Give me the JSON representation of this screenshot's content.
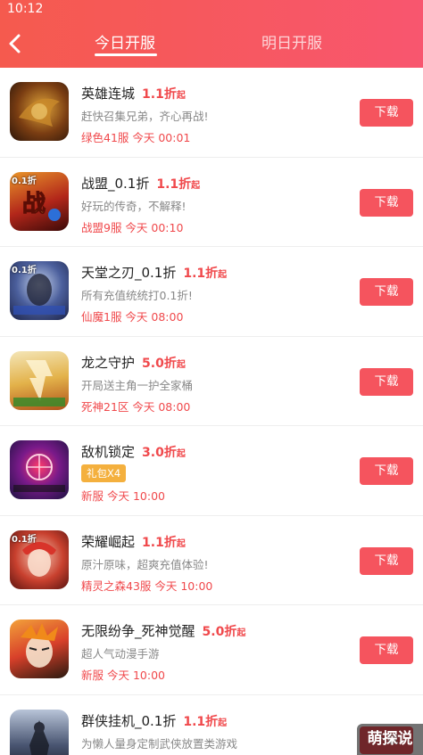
{
  "status": {
    "time": "10:12"
  },
  "header": {
    "tabs": [
      {
        "label": "今日开服",
        "active": true
      },
      {
        "label": "明日开服",
        "active": false
      }
    ]
  },
  "download_label": "下载",
  "games": [
    {
      "name": "英雄连城",
      "discount": "1.1折",
      "suffix": "起",
      "desc": "赶快召集兄弟，齐心再战!",
      "server": "绿色41服 今天 00:01",
      "icon": "hero-castle-icon"
    },
    {
      "name": "战盟_0.1折",
      "discount": "1.1折",
      "suffix": "起",
      "desc": "好玩的传奇，不解释!",
      "server": "战盟9服 今天 00:10",
      "icon": "war-alliance-icon",
      "badge": "0.1折"
    },
    {
      "name": "天堂之刃_0.1折",
      "discount": "1.1折",
      "suffix": "起",
      "desc": "所有充值统统打0.1折!",
      "server": "仙魔1服 今天 08:00",
      "icon": "heaven-blade-icon",
      "badge": "0.1折"
    },
    {
      "name": "龙之守护",
      "discount": "5.0折",
      "suffix": "起",
      "desc": "开局送主角一护全家桶",
      "server": "死神21区 今天 08:00",
      "icon": "dragon-guard-icon"
    },
    {
      "name": "敌机锁定",
      "discount": "3.0折",
      "suffix": "起",
      "gift": "礼包X4",
      "server": "新服 今天 10:00",
      "icon": "enemy-lock-icon"
    },
    {
      "name": "荣耀崛起",
      "discount": "1.1折",
      "suffix": "起",
      "desc": "原汁原味，超爽充值体验!",
      "server": "精灵之森43服 今天 10:00",
      "icon": "glory-rise-icon",
      "badge": "0.1折"
    },
    {
      "name": "无限纷争_死神觉醒",
      "discount": "5.0折",
      "suffix": "起",
      "desc": "超人气动漫手游",
      "server": "新服 今天 10:00",
      "icon": "infinite-strife-icon"
    },
    {
      "name": "群侠挂机_0.1折",
      "discount": "1.1折",
      "suffix": "起",
      "desc": "为懒人量身定制武侠放置类游戏",
      "server": "",
      "icon": "heroes-idle-icon"
    }
  ],
  "watermark": "萌探说",
  "colors": {
    "accent": "#f5545e",
    "header_start": "#f55a4e",
    "header_end": "#f8566f",
    "gift": "#f4b03e"
  }
}
